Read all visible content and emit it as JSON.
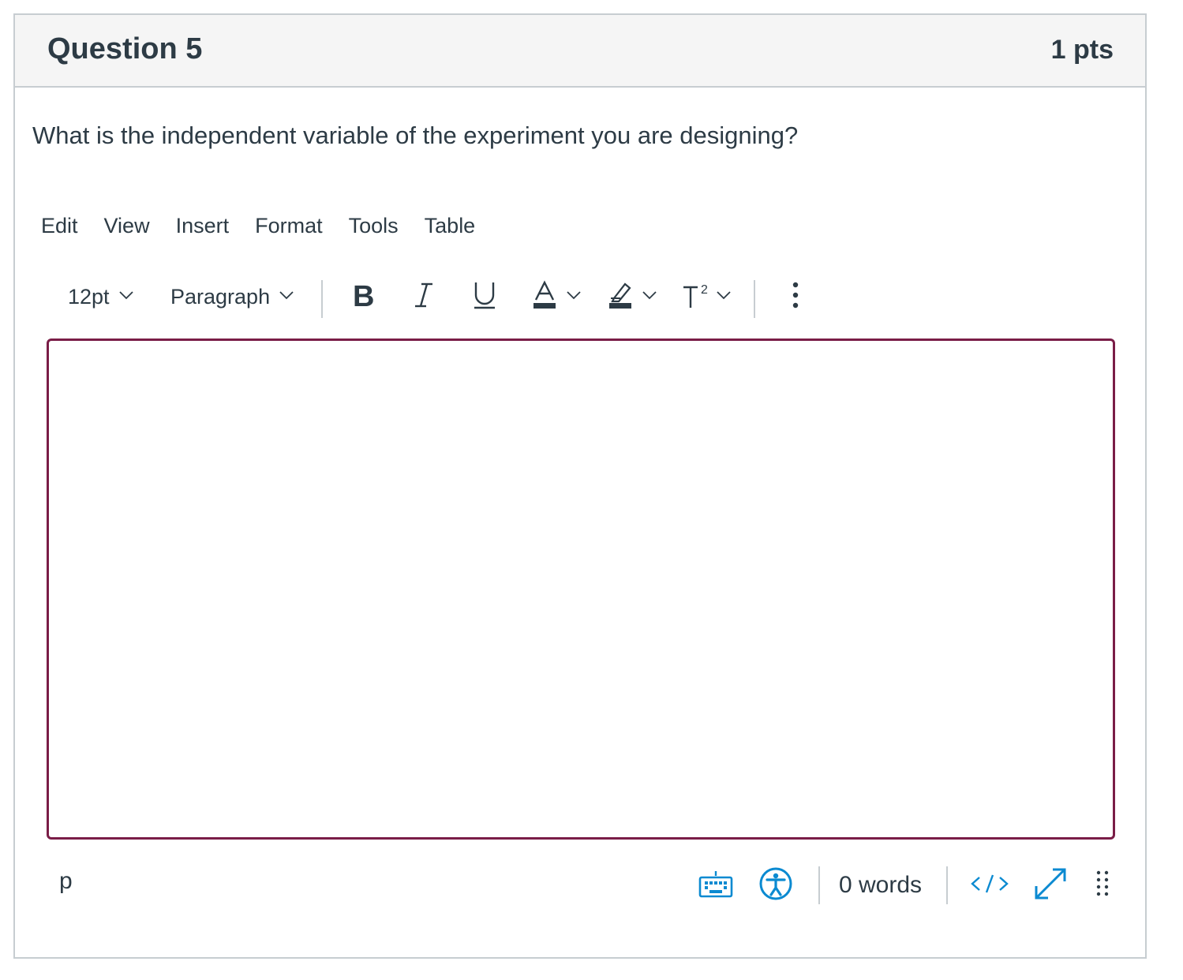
{
  "question": {
    "title": "Question 5",
    "points": "1 pts",
    "text": "What is the independent variable of the experiment you are designing?"
  },
  "menubar": {
    "items": [
      "Edit",
      "View",
      "Insert",
      "Format",
      "Tools",
      "Table"
    ]
  },
  "toolbar": {
    "font_size": "12pt",
    "block_format": "Paragraph",
    "icons": [
      "bold-icon",
      "italic-icon",
      "underline-icon",
      "text-color-icon",
      "highlight-icon",
      "superscript-icon",
      "more-options-icon"
    ]
  },
  "editor": {
    "content": "",
    "border_color": "#7a1d47"
  },
  "statusbar": {
    "path": "p",
    "word_count": "0 words",
    "icons": [
      "keyboard-shortcuts-icon",
      "accessibility-checker-icon",
      "html-editor-icon",
      "fullscreen-icon",
      "resize-handle-icon"
    ],
    "accent_color": "#0b8ad1"
  }
}
